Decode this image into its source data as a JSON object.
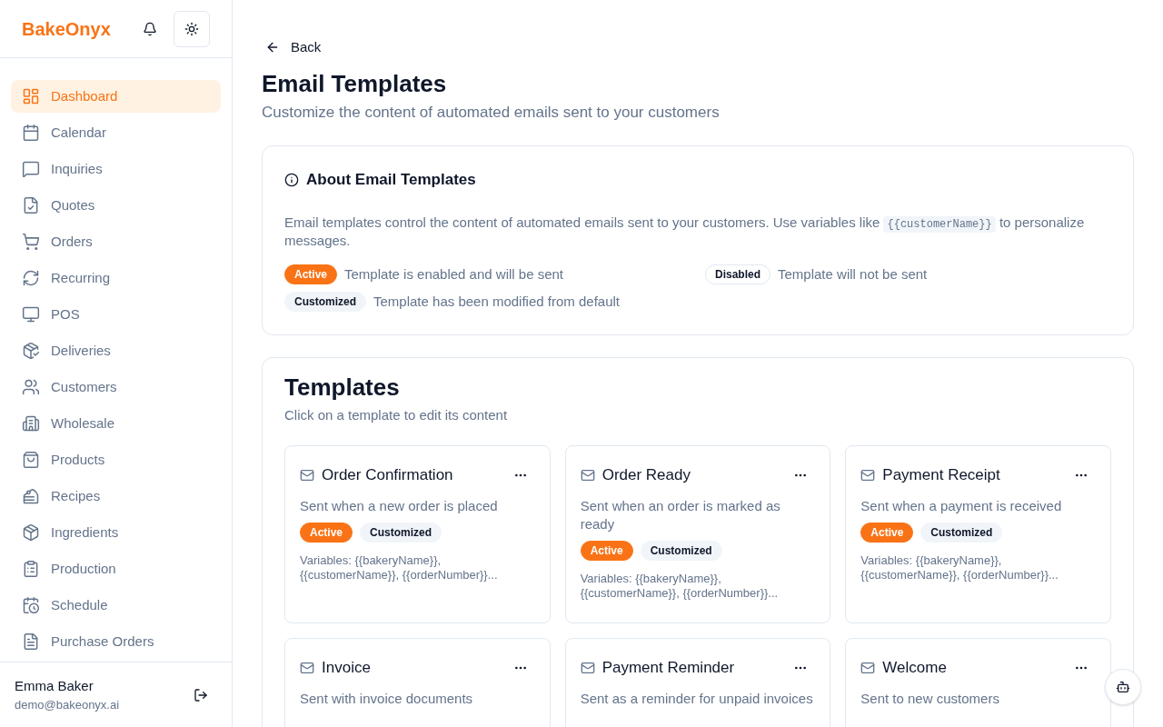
{
  "brand": "BakeOnyx",
  "sidebar": {
    "items": [
      {
        "label": "Dashboard",
        "selected": true
      },
      {
        "label": "Calendar",
        "selected": false
      },
      {
        "label": "Inquiries",
        "selected": false
      },
      {
        "label": "Quotes",
        "selected": false
      },
      {
        "label": "Orders",
        "selected": false
      },
      {
        "label": "Recurring",
        "selected": false
      },
      {
        "label": "POS",
        "selected": false
      },
      {
        "label": "Deliveries",
        "selected": false
      },
      {
        "label": "Customers",
        "selected": false
      },
      {
        "label": "Wholesale",
        "selected": false
      },
      {
        "label": "Products",
        "selected": false
      },
      {
        "label": "Recipes",
        "selected": false
      },
      {
        "label": "Ingredients",
        "selected": false
      },
      {
        "label": "Production",
        "selected": false
      },
      {
        "label": "Schedule",
        "selected": false
      },
      {
        "label": "Purchase Orders",
        "selected": false
      }
    ],
    "user": {
      "name": "Emma Baker",
      "email": "demo@bakeonyx.ai"
    }
  },
  "back": "Back",
  "title": "Email Templates",
  "subtitle": "Customize the content of automated emails sent to your customers",
  "about": {
    "title": "About Email Templates",
    "text_before": "Email templates control the content of automated emails sent to your customers. Use variables like",
    "code": "{{customerName}}",
    "text_after": "to personalize messages.",
    "legend": [
      {
        "kind": "active",
        "badge": "Active",
        "text": "Template is enabled and will be sent"
      },
      {
        "kind": "disabled",
        "badge": "Disabled",
        "text": "Template will not be sent"
      },
      {
        "kind": "customized",
        "badge": "Customized",
        "text": "Template has been modified from default"
      }
    ]
  },
  "templates": {
    "title": "Templates",
    "subtitle": "Click on a template to edit its content",
    "cards": [
      {
        "name": "Order Confirmation",
        "description": "Sent when a new order is placed",
        "badges": [
          {
            "kind": "active",
            "label": "Active"
          },
          {
            "kind": "customized",
            "label": "Customized"
          }
        ],
        "variables_label": "Variables:",
        "variables": "{{bakeryName}}, {{customerName}}, {{orderNumber}}..."
      },
      {
        "name": "Order Ready",
        "description": "Sent when an order is marked as ready",
        "badges": [
          {
            "kind": "active",
            "label": "Active"
          },
          {
            "kind": "customized",
            "label": "Customized"
          }
        ],
        "variables_label": "Variables:",
        "variables": "{{bakeryName}}, {{customerName}}, {{orderNumber}}..."
      },
      {
        "name": "Payment Receipt",
        "description": "Sent when a payment is received",
        "badges": [
          {
            "kind": "active",
            "label": "Active"
          },
          {
            "kind": "customized",
            "label": "Customized"
          }
        ],
        "variables_label": "Variables:",
        "variables": "{{bakeryName}}, {{customerName}}, {{orderNumber}}..."
      },
      {
        "name": "Invoice",
        "description": "Sent with invoice documents"
      },
      {
        "name": "Payment Reminder",
        "description": "Sent as a reminder for unpaid invoices"
      },
      {
        "name": "Welcome",
        "description": "Sent to new customers"
      }
    ]
  }
}
